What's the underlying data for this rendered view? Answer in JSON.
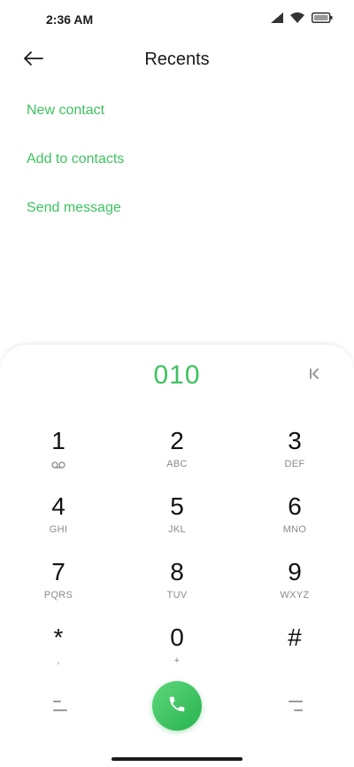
{
  "status_bar": {
    "time": "2:36 AM",
    "icons": [
      "signal-icon",
      "wifi-icon",
      "battery-icon"
    ]
  },
  "app_bar": {
    "title": "Recents",
    "back_icon": "arrow-left-icon"
  },
  "actions": {
    "new_contact": "New contact",
    "add_to_contacts": "Add to contacts",
    "send_message": "Send message"
  },
  "dialpad": {
    "number": "010",
    "backspace_icon": "backspace-icon",
    "keys": [
      {
        "digit": "1",
        "letters": "",
        "sub_icon": "voicemail-icon"
      },
      {
        "digit": "2",
        "letters": "ABC"
      },
      {
        "digit": "3",
        "letters": "DEF"
      },
      {
        "digit": "4",
        "letters": "GHI"
      },
      {
        "digit": "5",
        "letters": "JKL"
      },
      {
        "digit": "6",
        "letters": "MNO"
      },
      {
        "digit": "7",
        "letters": "PQRS"
      },
      {
        "digit": "8",
        "letters": "TUV"
      },
      {
        "digit": "9",
        "letters": "WXYZ"
      },
      {
        "digit": "*",
        "letters": ","
      },
      {
        "digit": "0",
        "letters": "+"
      },
      {
        "digit": "#",
        "letters": ""
      }
    ],
    "call_icon": "phone-icon"
  },
  "colors": {
    "accent": "#3fc261",
    "call_button": "#2fbd57"
  }
}
